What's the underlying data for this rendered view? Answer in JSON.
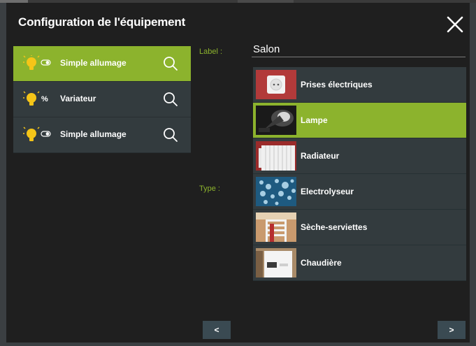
{
  "modal": {
    "title": "Configuration de l'équipement"
  },
  "devices": [
    {
      "label": "Simple allumage",
      "icon": "bulb-switch-icon",
      "active": true
    },
    {
      "label": "Variateur",
      "icon": "bulb-dimmer-icon",
      "active": false
    },
    {
      "label": "Simple allumage",
      "icon": "bulb-switch-icon",
      "active": false
    }
  ],
  "form": {
    "label_field_label": "Label :",
    "label_value": "Salon",
    "type_field_label": "Type :"
  },
  "types": [
    {
      "label": "Prises électriques",
      "thumb": "socket-photo",
      "active": false
    },
    {
      "label": "Lampe",
      "thumb": "lamp-photo",
      "active": true
    },
    {
      "label": "Radiateur",
      "thumb": "radiator-photo",
      "active": false
    },
    {
      "label": "Electrolyseur",
      "thumb": "electrolyser-photo",
      "active": false
    },
    {
      "label": "Sèche-serviettes",
      "thumb": "towel-dryer-photo",
      "active": false
    },
    {
      "label": "Chaudière",
      "thumb": "boiler-photo",
      "active": false
    }
  ],
  "nav": {
    "prev_label": "<",
    "next_label": ">"
  },
  "colors": {
    "accent": "#8cb32d",
    "panel": "#333b3e",
    "modal_bg": "#1f1f1f",
    "bulb": "#f5c518"
  }
}
